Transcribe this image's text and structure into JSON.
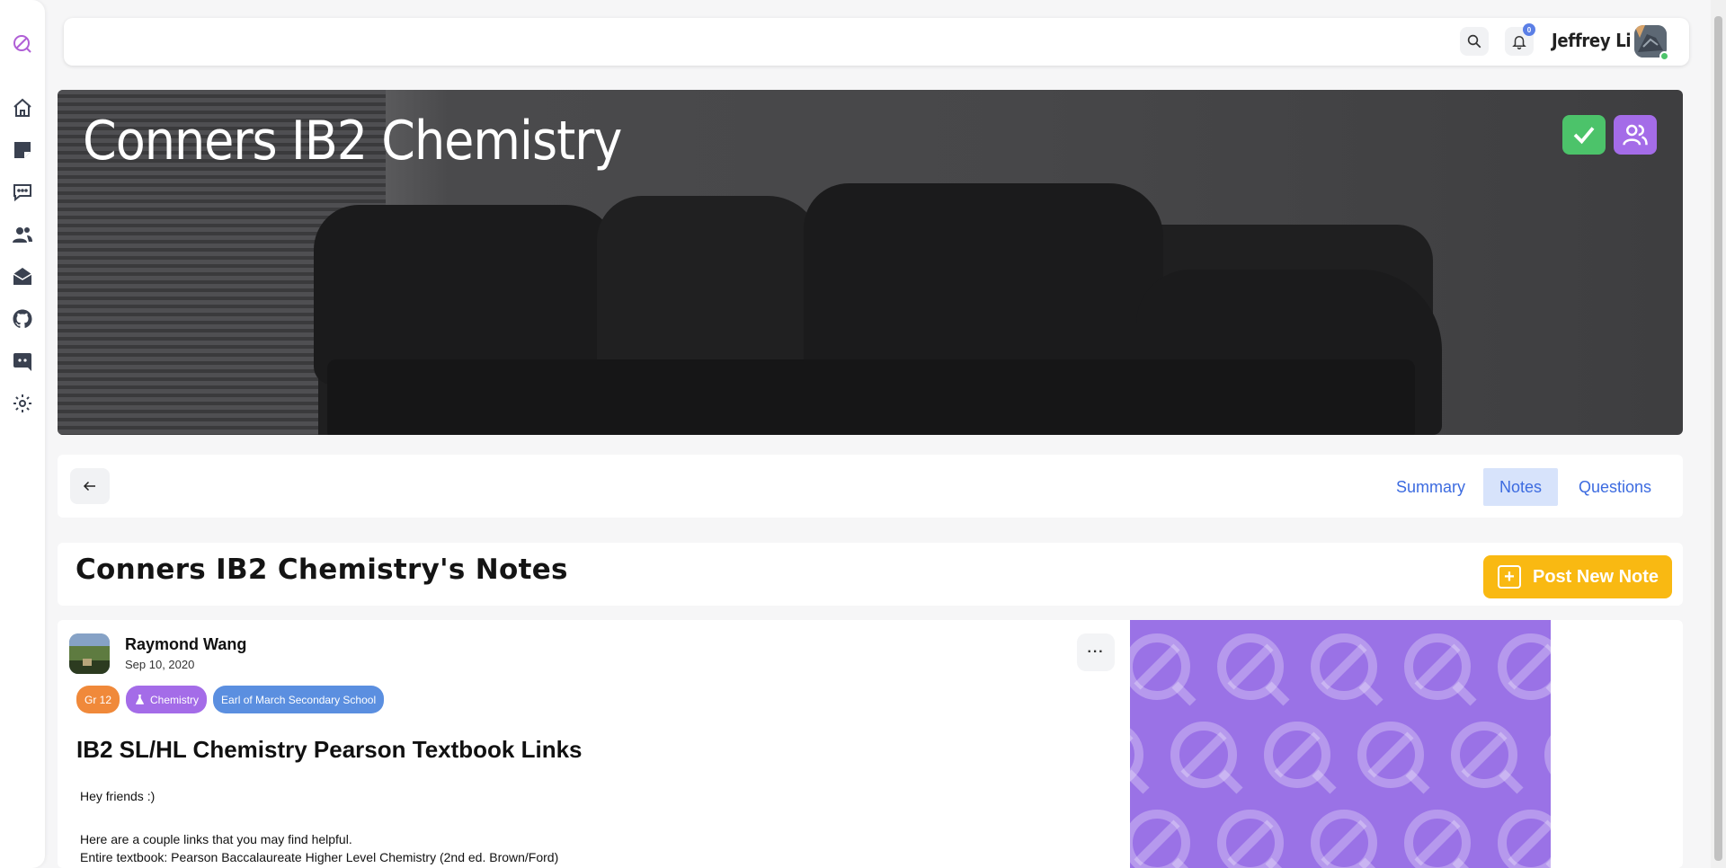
{
  "app": {
    "brand_icon": "quiz-logo-icon"
  },
  "sidebar": {
    "items": [
      {
        "icon": "home-icon"
      },
      {
        "icon": "note-icon"
      },
      {
        "icon": "chat-icon"
      },
      {
        "icon": "users-icon"
      },
      {
        "icon": "inbox-icon"
      },
      {
        "icon": "github-icon"
      },
      {
        "icon": "discord-icon"
      },
      {
        "icon": "settings-icon"
      }
    ]
  },
  "topbar": {
    "notification_count": "0",
    "user_name": "Jeffrey Li"
  },
  "banner": {
    "title": "Conners IB2 Chemistry"
  },
  "tabs": {
    "items": [
      {
        "label": "Summary",
        "active": false
      },
      {
        "label": "Notes",
        "active": true
      },
      {
        "label": "Questions",
        "active": false
      }
    ]
  },
  "notes_section": {
    "title": "Conners IB2 Chemistry's Notes",
    "post_button_label": "Post New Note"
  },
  "note": {
    "author": "Raymond Wang",
    "date": "Sep 10, 2020",
    "tags": [
      {
        "label": "Gr 12",
        "color": "#f0893a"
      },
      {
        "label": "Chemistry",
        "color": "#a46ce8"
      },
      {
        "label": "Earl of March Secondary School",
        "color": "#5b8fe0"
      }
    ],
    "title": "IB2 SL/HL Chemistry Pearson Textbook Links",
    "body": [
      "Hey friends :)",
      "",
      "Here are a couple links that you may find helpful.",
      "Entire textbook: Pearson Baccalaureate Higher Level Chemistry (2nd ed. Brown/Ford)"
    ],
    "more_label": "···"
  },
  "colors": {
    "accent_blue": "#3c6be0",
    "accent_yellow": "#f9b912",
    "accent_purple": "#9a72e6",
    "check_green": "#4cc36a",
    "group_purple": "#a46ce8"
  }
}
